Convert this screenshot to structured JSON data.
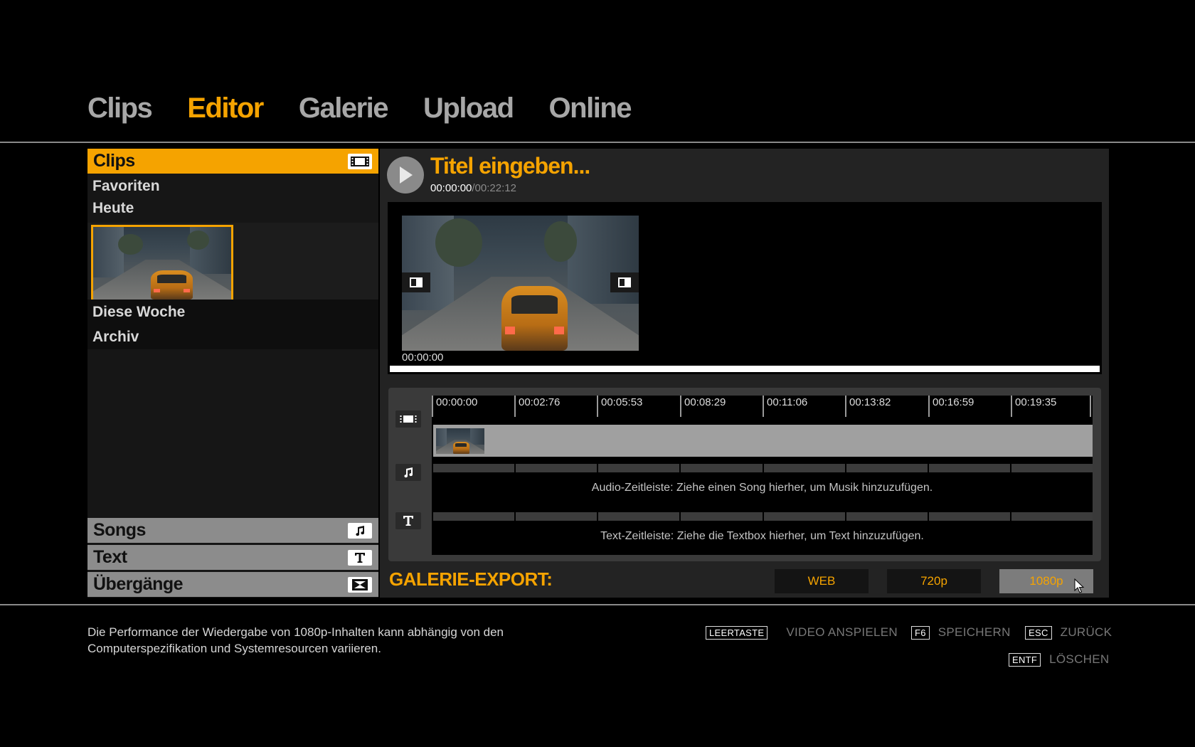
{
  "nav": {
    "tabs": [
      "Clips",
      "Editor",
      "Galerie",
      "Upload",
      "Online"
    ],
    "active": "Editor"
  },
  "library": {
    "clips_header": "Clips",
    "favorites": "Favoriten",
    "today": "Heute",
    "this_week": "Diese Woche",
    "archive": "Archiv",
    "songs": "Songs",
    "text": "Text",
    "transitions": "Übergänge"
  },
  "editor": {
    "title": "Titel eingeben...",
    "time_current": "00:00:00",
    "time_total": "/00:22:12",
    "preview_time": "00:00:00"
  },
  "timeline": {
    "ticks": [
      "00:00:00",
      "00:02:76",
      "00:05:53",
      "00:08:29",
      "00:11:06",
      "00:13:82",
      "00:16:59",
      "00:19:35"
    ],
    "audio_msg": "Audio-Zeitleiste: Ziehe einen Song hierher, um Musik hinzuzufügen.",
    "text_msg": "Text-Zeitleiste: Ziehe die Textbox hierher, um Text hinzuzufügen."
  },
  "export": {
    "label": "GALERIE-EXPORT:",
    "web": "WEB",
    "p720": "720p",
    "p1080": "1080p",
    "selected": "1080p"
  },
  "footer": {
    "note": "Die Performance der Wiedergabe von 1080p-Inhalten kann abhängig von den Computerspezifikation und Systemresourcen variieren.",
    "space_key": "LEERTASTE",
    "space_action": "VIDEO ANSPIELEN",
    "f6_key": "F6",
    "f6_action": "SPEICHERN",
    "esc_key": "ESC",
    "esc_action": "ZURÜCK",
    "del_key": "ENTF",
    "del_action": "LÖSCHEN"
  },
  "colors": {
    "accent": "#f5a300",
    "panel": "#232323",
    "background": "#000000"
  }
}
